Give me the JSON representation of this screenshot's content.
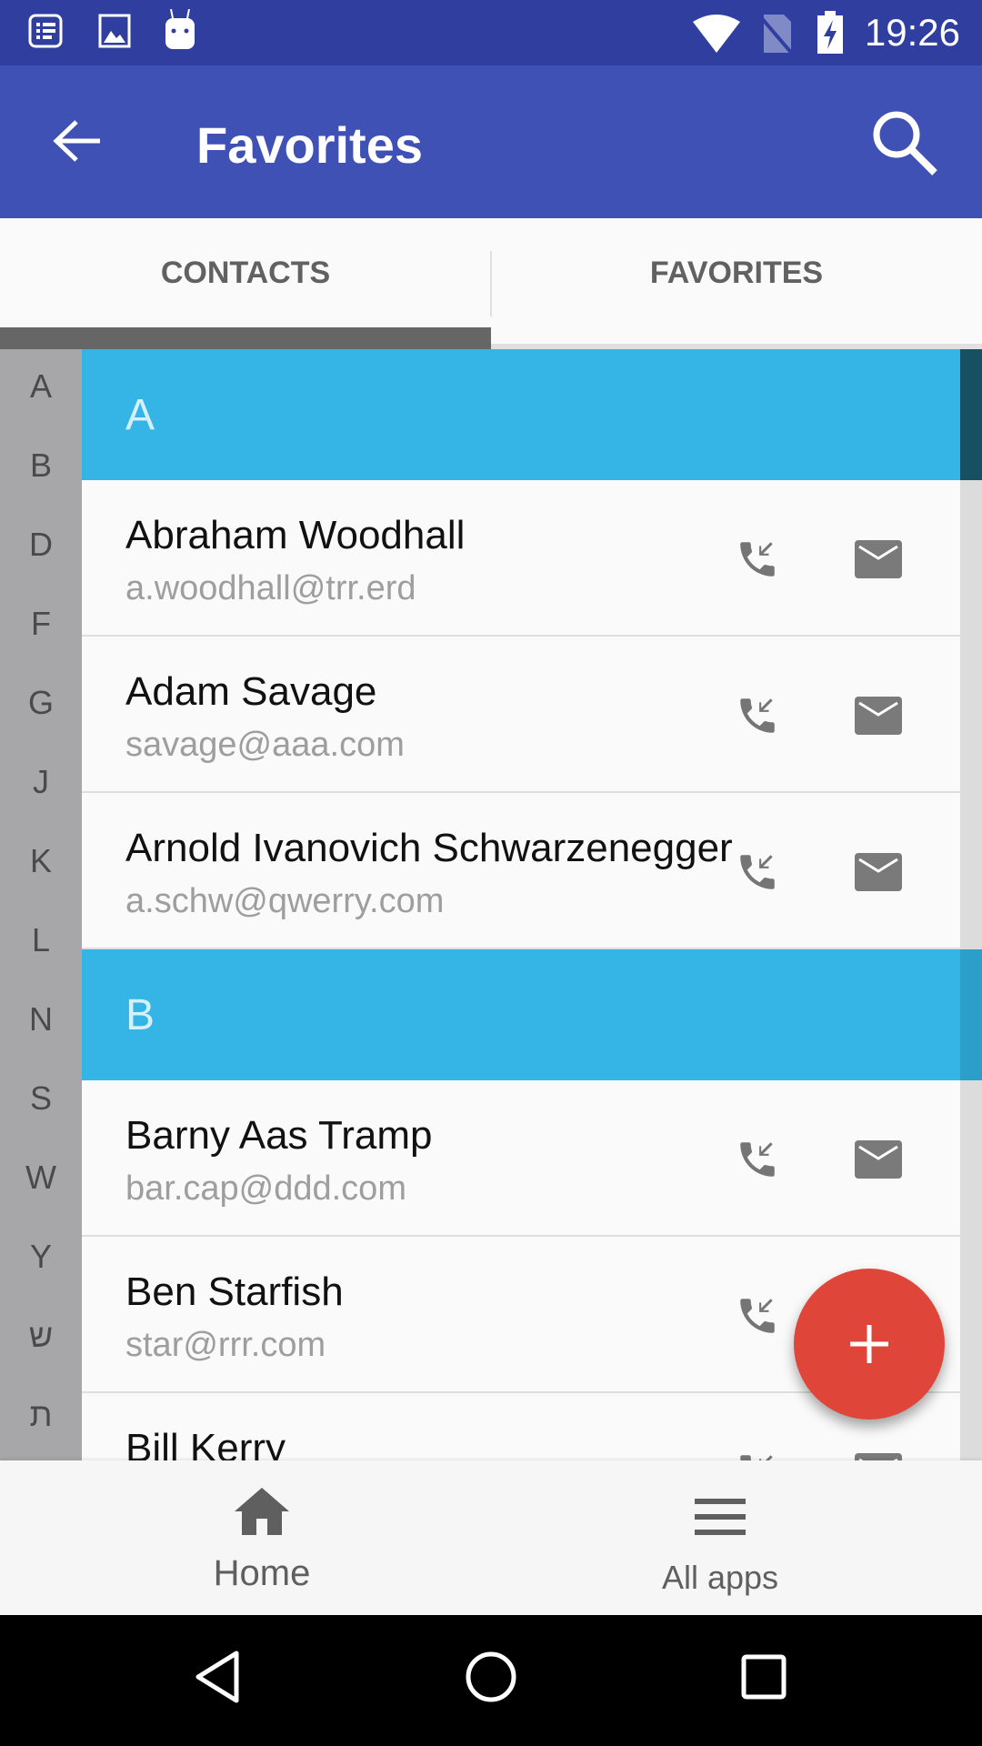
{
  "status_bar": {
    "time": "19:26",
    "icons": [
      "notification-list-icon",
      "image-icon",
      "android-icon",
      "wifi-icon",
      "no-sim-icon",
      "battery-charging-icon"
    ]
  },
  "app_bar": {
    "title": "Favorites",
    "back_icon": "arrow-left-icon",
    "search_icon": "search-icon"
  },
  "tabs": [
    {
      "label": "CONTACTS",
      "selected": true
    },
    {
      "label": "FAVORITES",
      "selected": false
    }
  ],
  "index_letters": [
    "A",
    "B",
    "D",
    "F",
    "G",
    "J",
    "K",
    "L",
    "N",
    "S",
    "W",
    "Y",
    "ש",
    "ת"
  ],
  "sections": [
    {
      "letter": "A",
      "contacts": [
        {
          "name": "Abraham Woodhall",
          "email": "a.woodhall@trr.erd"
        },
        {
          "name": "Adam Savage",
          "email": "savage@aaa.com"
        },
        {
          "name": "Arnold Ivanovich Schwarzenegger",
          "email": "a.schw@qwerry.com"
        }
      ]
    },
    {
      "letter": "B",
      "contacts": [
        {
          "name": "Barny Aas Tramp",
          "email": "bar.cap@ddd.com"
        },
        {
          "name": "Ben Starfish",
          "email": "star@rrr.com"
        },
        {
          "name": "Bill Kerry",
          "email": ""
        }
      ]
    }
  ],
  "fab": {
    "icon": "plus-icon",
    "color": "#e0453a"
  },
  "bottom_nav": [
    {
      "label": "Home",
      "icon": "home-icon"
    },
    {
      "label": "All apps",
      "icon": "menu-icon"
    }
  ],
  "colors": {
    "primary": "#3f51b5",
    "primary_dark": "#303f9f",
    "section_header": "#35b5e5"
  }
}
